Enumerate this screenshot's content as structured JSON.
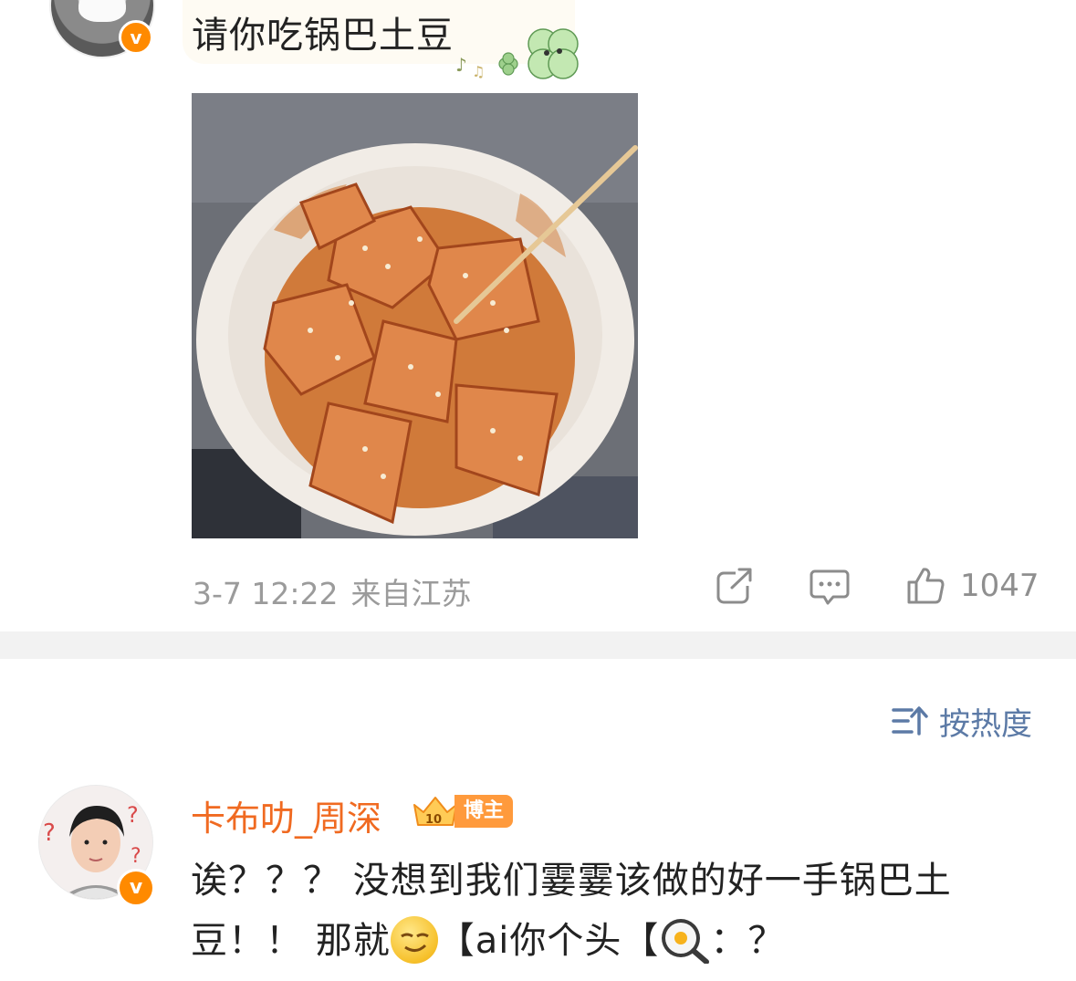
{
  "post": {
    "text": "请你吃锅巴土豆",
    "image_alt": "锅巴土豆",
    "time": "3-7 12:22",
    "location": "来自江苏",
    "like_count": "1047",
    "icons": [
      "share-icon",
      "comment-icon",
      "like-icon"
    ]
  },
  "sort": {
    "label": "按热度",
    "icon": "sort-icon"
  },
  "comment": {
    "username": "卡布叻_周深",
    "badge_level": "10",
    "badge_label": "博主",
    "text_part1": "诶？？？ 没想到我们霎霎该做的好一手锅巴土豆！！ 那就",
    "text_part2": "【ai你个头【",
    "text_part3": "：？",
    "emojis": [
      "smirk-face-emoji",
      "frying-pan-egg-emoji"
    ]
  },
  "colors": {
    "username": "#f06a21",
    "verified_badge": "#ff8a00",
    "sort_label": "#5c7aa6",
    "meta_text": "#9b9b9b",
    "divider": "#f2f2f2"
  }
}
